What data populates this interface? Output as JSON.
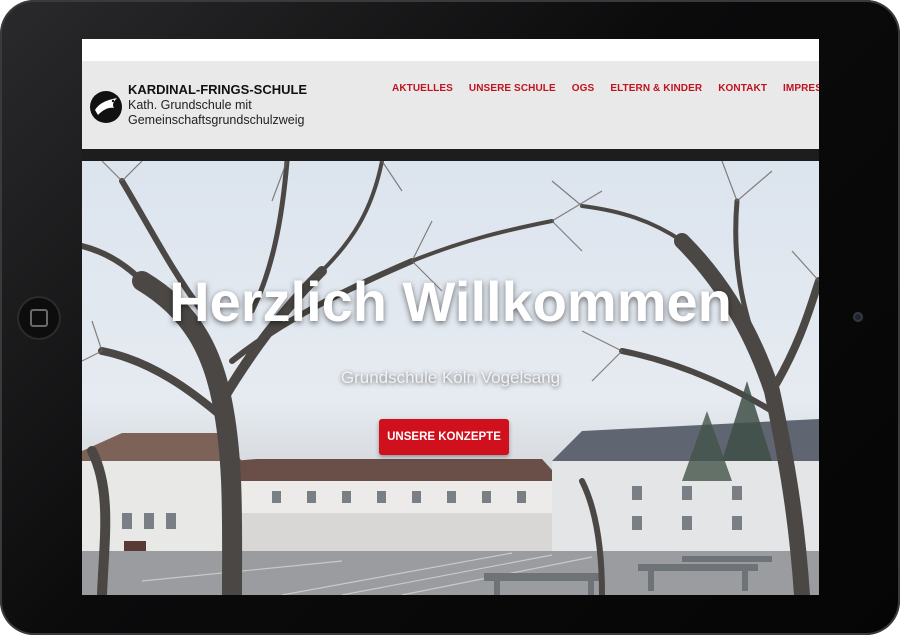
{
  "site": {
    "title": "KARDINAL-FRINGS-SCHULE",
    "subtitle_line1": "Kath. Grundschule mit",
    "subtitle_line2": "Gemeinschaftsgrundschulzweig",
    "logo_icon": "dove-icon"
  },
  "nav": {
    "items": [
      {
        "label": "AKTUELLES"
      },
      {
        "label": "UNSERE SCHULE"
      },
      {
        "label": "OGS"
      },
      {
        "label": "ELTERN & KINDER"
      },
      {
        "label": "KONTAKT"
      },
      {
        "label": "IMPRESSUM"
      }
    ]
  },
  "hero": {
    "title": "Herzlich Willkommen",
    "subtitle": "Grundschule Köln Vogelsang",
    "cta_label": "UNSERE KONZEPTE"
  },
  "colors": {
    "accent": "#c1121f",
    "button": "#d0101c",
    "header_bg": "#e9e9e9",
    "device_bezel": "#0b0b0c"
  }
}
